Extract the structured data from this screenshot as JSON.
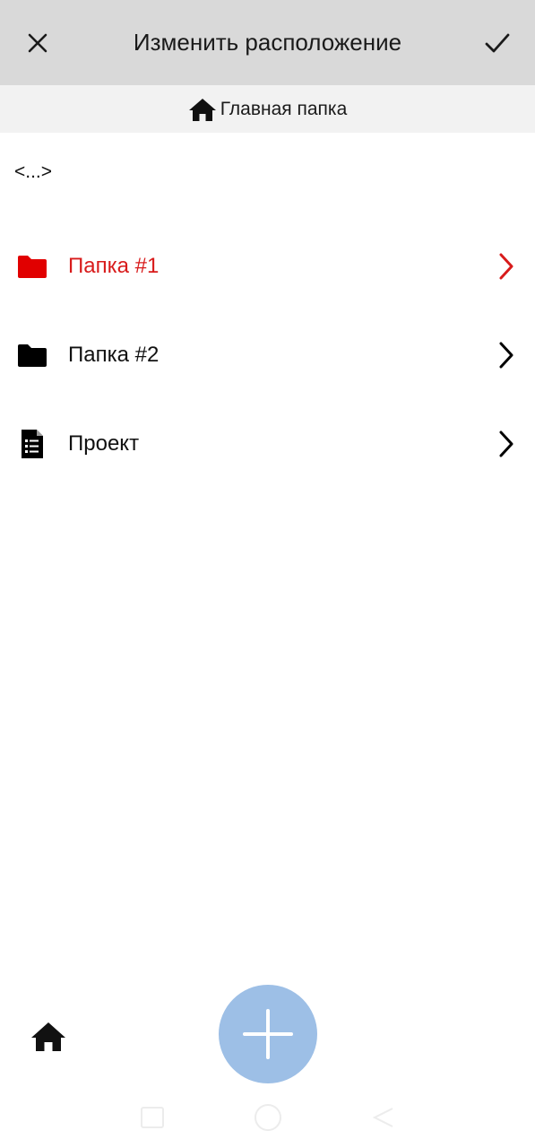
{
  "header": {
    "title": "Изменить расположение",
    "close_icon": "close-icon",
    "confirm_icon": "check-icon"
  },
  "breadcrumb": {
    "icon": "home-icon",
    "label": "Главная папка"
  },
  "navigation": {
    "up_label": "<...>"
  },
  "items": [
    {
      "label": "Папка #1",
      "icon": "folder-icon",
      "selected": true
    },
    {
      "label": "Папка #2",
      "icon": "folder-icon",
      "selected": false
    },
    {
      "label": "Проект",
      "icon": "document-list-icon",
      "selected": false
    }
  ],
  "bottom_bar": {
    "home_icon": "home-icon",
    "add_icon": "plus-icon"
  },
  "colors": {
    "header_bg": "#d9d9d9",
    "breadcrumb_bg": "#f2f2f2",
    "accent": "#d81b1b",
    "fab": "#9dbfe6"
  }
}
